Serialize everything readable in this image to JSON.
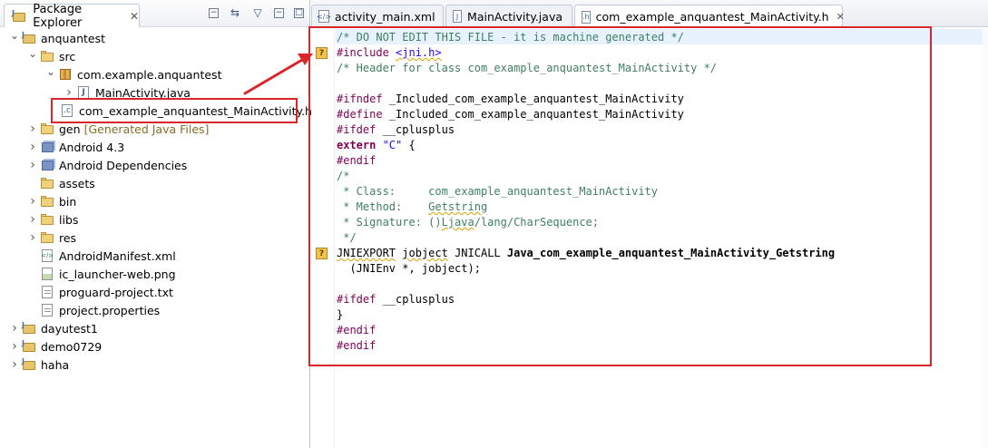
{
  "package_explorer": {
    "title": "Package Explorer",
    "tree": [
      {
        "label": "anquantest",
        "expanded": true,
        "icon": "project-icon"
      },
      {
        "label": "src",
        "expanded": true,
        "icon": "source-folder-icon"
      },
      {
        "label": "com.example.anquantest",
        "expanded": true,
        "icon": "package-icon"
      },
      {
        "label": "MainActivity.java",
        "expanded": false,
        "icon": "java-file-icon"
      },
      {
        "label": "com_example_anquantest_MainActivity.h",
        "icon": "c-header-file-icon"
      },
      {
        "label": "gen",
        "decoration": "[Generated Java Files]",
        "expanded": false,
        "icon": "source-folder-icon"
      },
      {
        "label": "Android 4.3",
        "expanded": false,
        "icon": "library-icon"
      },
      {
        "label": "Android Dependencies",
        "expanded": false,
        "icon": "library-icon"
      },
      {
        "label": "assets",
        "icon": "folder-icon"
      },
      {
        "label": "bin",
        "expanded": false,
        "icon": "folder-icon"
      },
      {
        "label": "libs",
        "expanded": false,
        "icon": "folder-icon"
      },
      {
        "label": "res",
        "expanded": false,
        "icon": "folder-icon"
      },
      {
        "label": "AndroidManifest.xml",
        "icon": "xml-file-icon"
      },
      {
        "label": "ic_launcher-web.png",
        "icon": "image-file-icon"
      },
      {
        "label": "proguard-project.txt",
        "icon": "text-file-icon"
      },
      {
        "label": "project.properties",
        "icon": "text-file-icon"
      },
      {
        "label": "dayutest1",
        "expanded": false,
        "icon": "project-icon"
      },
      {
        "label": "demo0729",
        "expanded": false,
        "icon": "project-icon"
      },
      {
        "label": "haha",
        "expanded": false,
        "icon": "project-icon"
      }
    ]
  },
  "editor": {
    "tabs": [
      {
        "label": "activity_main.xml",
        "active": false
      },
      {
        "label": "MainActivity.java",
        "active": false
      },
      {
        "label": "com_example_anquantest_MainActivity.h",
        "active": true
      }
    ],
    "lines": [
      [
        {
          "t": "/* DO NOT EDIT THIS FILE - it is machine generated */",
          "c": "cm"
        }
      ],
      [
        {
          "t": "#include ",
          "c": "kw"
        },
        {
          "t": "<jni.h>",
          "c": "str warn"
        }
      ],
      [
        {
          "t": "/* Header for class com_example_anquantest_MainActivity */",
          "c": "cm"
        }
      ],
      [
        {
          "t": "",
          "c": "pl"
        }
      ],
      [
        {
          "t": "#ifndef ",
          "c": "kw"
        },
        {
          "t": "_Included_com_example_anquantest_MainActivity",
          "c": "pl"
        }
      ],
      [
        {
          "t": "#define ",
          "c": "kw"
        },
        {
          "t": "_Included_com_example_anquantest_MainActivity",
          "c": "pl"
        }
      ],
      [
        {
          "t": "#ifdef ",
          "c": "kw"
        },
        {
          "t": "__cplusplus",
          "c": "pl"
        }
      ],
      [
        {
          "t": "extern ",
          "c": "kw bold"
        },
        {
          "t": "\"C\"",
          "c": "str"
        },
        {
          "t": " {",
          "c": "pl"
        }
      ],
      [
        {
          "t": "#endif",
          "c": "kw"
        }
      ],
      [
        {
          "t": "/*",
          "c": "cm"
        }
      ],
      [
        {
          "t": " * Class:     com_example_anquantest_MainActivity",
          "c": "cm"
        }
      ],
      [
        {
          "t": " * Method:    ",
          "c": "cm"
        },
        {
          "t": "Getstring",
          "c": "cm warn"
        }
      ],
      [
        {
          "t": " * Signature: ()",
          "c": "cm"
        },
        {
          "t": "Ljava",
          "c": "cm warn"
        },
        {
          "t": "/lang/CharSequence;",
          "c": "cm"
        }
      ],
      [
        {
          "t": " */",
          "c": "cm"
        }
      ],
      [
        {
          "t": "JNIEXPORT",
          "c": "pl warn"
        },
        {
          "t": " ",
          "c": "pl"
        },
        {
          "t": "jobject",
          "c": "pl warn"
        },
        {
          "t": " JNICALL ",
          "c": "pl"
        },
        {
          "t": "Java_com_example_anquantest_MainActivity_Getstring",
          "c": "pl bold"
        }
      ],
      [
        {
          "t": "  (JNIEnv *, jobject);",
          "c": "pl"
        }
      ],
      [
        {
          "t": "",
          "c": "pl"
        }
      ],
      [
        {
          "t": "#ifdef ",
          "c": "kw"
        },
        {
          "t": "__cplusplus",
          "c": "pl"
        }
      ],
      [
        {
          "t": "}",
          "c": "pl"
        }
      ],
      [
        {
          "t": "#endif",
          "c": "kw"
        }
      ],
      [
        {
          "t": "#endif",
          "c": "kw"
        }
      ]
    ],
    "markers": [
      {
        "line": 2,
        "symbol": "?"
      },
      {
        "line": 15,
        "symbol": "?"
      }
    ]
  },
  "colors": {
    "annotation_red": "#d9262b",
    "comment": "#3f7f5f",
    "keyword": "#7f0055",
    "string": "#2a00ff"
  }
}
